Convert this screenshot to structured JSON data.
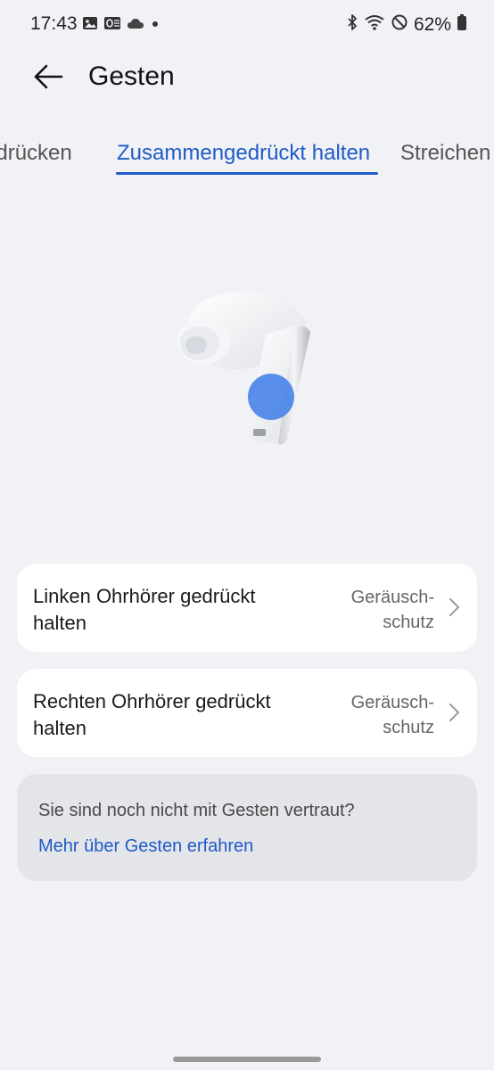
{
  "status_bar": {
    "time": "17:43",
    "battery_percent": "62%",
    "left_icons": [
      "image-icon",
      "outlook-icon",
      "cloud-icon",
      "dot-icon"
    ],
    "right_icons": [
      "bluetooth-icon",
      "wifi-icon",
      "do-not-disturb-icon",
      "battery-icon"
    ]
  },
  "header": {
    "title": "Gesten"
  },
  "tabs": [
    {
      "label": "Zweimal drücken",
      "visible_text": "ndrücken",
      "active": false
    },
    {
      "label": "Zusammengedrückt halten",
      "visible_text": "Zusammengedrückt halten",
      "active": true
    },
    {
      "label": "Streichen",
      "visible_text": "Streichen",
      "active": false
    }
  ],
  "colors": {
    "accent": "#1f5ac8",
    "background": "#f1f2f6",
    "card": "#ffffff",
    "info_box": "#e4e5e9",
    "touch_indicator": "#3d7de8"
  },
  "settings": [
    {
      "label": "Linken Ohrhörer gedrückt halten",
      "value": "Geräusch-schutz"
    },
    {
      "label": "Rechten Ohrhörer gedrückt halten",
      "value": "Geräusch-schutz"
    }
  ],
  "info": {
    "text": "Sie sind noch nicht mit Gesten vertraut?",
    "link": "Mehr über Gesten erfahren"
  }
}
